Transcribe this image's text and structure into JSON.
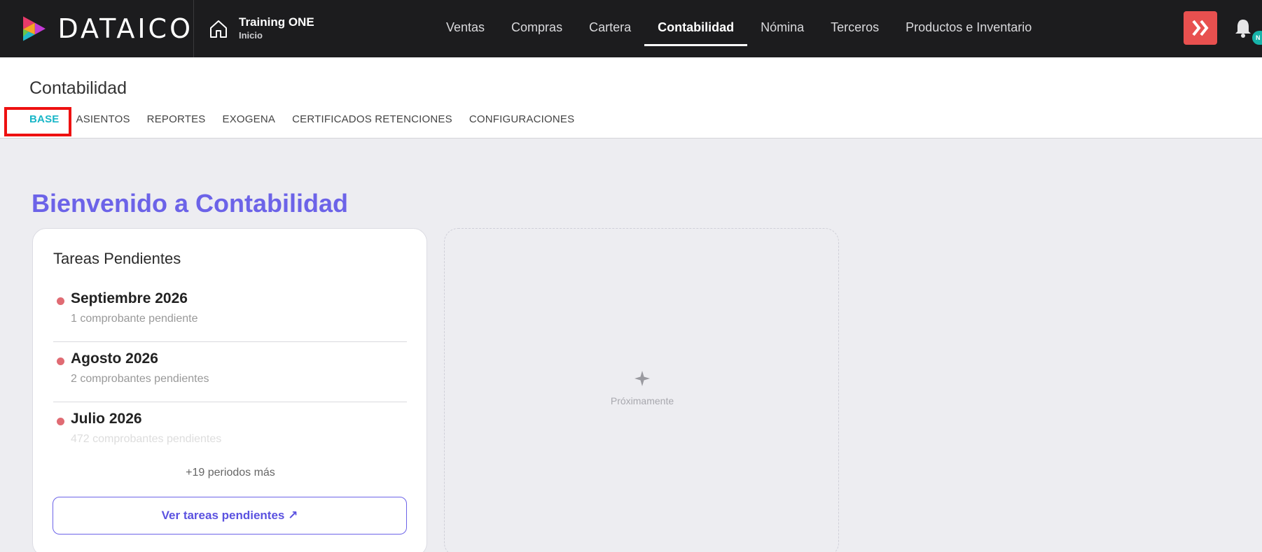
{
  "brand": {
    "logo_text": "DATAICO"
  },
  "company": {
    "name": "Training ONE",
    "subtitle": "Inicio"
  },
  "nav": {
    "items": [
      {
        "label": "Ventas"
      },
      {
        "label": "Compras"
      },
      {
        "label": "Cartera"
      },
      {
        "label": "Contabilidad",
        "active": true
      },
      {
        "label": "Nómina"
      },
      {
        "label": "Terceros"
      },
      {
        "label": "Productos e Inventario"
      }
    ]
  },
  "notifications": {
    "badge": "N"
  },
  "page": {
    "title": "Contabilidad",
    "tabs": [
      {
        "label": "BASE",
        "active": true
      },
      {
        "label": "ASIENTOS"
      },
      {
        "label": "REPORTES"
      },
      {
        "label": "EXOGENA"
      },
      {
        "label": "CERTIFICADOS RETENCIONES"
      },
      {
        "label": "CONFIGURACIONES"
      }
    ]
  },
  "welcome": {
    "heading": "Bienvenido a Contabilidad"
  },
  "tasks": {
    "title": "Tareas Pendientes",
    "items": [
      {
        "period": "Septiembre 2026",
        "detail": "1 comprobante pendiente"
      },
      {
        "period": "Agosto 2026",
        "detail": "2 comprobantes pendientes"
      },
      {
        "period": "Julio 2026",
        "detail": "472 comprobantes pendientes"
      }
    ],
    "more": "+19 periodos más",
    "button_label": "Ver tareas pendientes ↗"
  },
  "placeholder": {
    "label": "Próximamente"
  },
  "colors": {
    "accent": "#6c63e8",
    "tab_active": "#17b6c7",
    "brand_red": "#e8504f",
    "dot": "#e06b73",
    "highlight": "#ee1111"
  }
}
